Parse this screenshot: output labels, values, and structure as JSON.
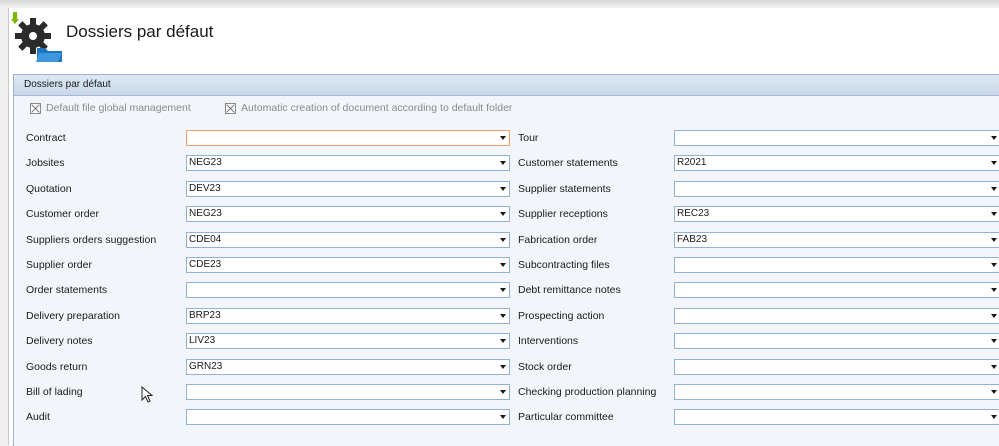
{
  "window": {
    "title": "Dossiers par défaut"
  },
  "panel": {
    "title": "Dossiers par défaut"
  },
  "options": {
    "global_management": "Default file global management",
    "auto_creation": "Automatic creation of document according to default folder"
  },
  "left_fields": [
    {
      "label": "Contract",
      "value": ""
    },
    {
      "label": "Jobsites",
      "value": "NEG23"
    },
    {
      "label": "Quotation",
      "value": "DEV23"
    },
    {
      "label": "Customer order",
      "value": "NEG23"
    },
    {
      "label": "Suppliers orders suggestion",
      "value": "CDE04"
    },
    {
      "label": "Supplier order",
      "value": "CDE23"
    },
    {
      "label": "Order statements",
      "value": ""
    },
    {
      "label": "Delivery preparation",
      "value": "BRP23"
    },
    {
      "label": "Delivery notes",
      "value": "LIV23"
    },
    {
      "label": "Goods return",
      "value": "GRN23"
    },
    {
      "label": "Bill of lading",
      "value": ""
    },
    {
      "label": "Audit",
      "value": ""
    }
  ],
  "right_fields": [
    {
      "label": "Tour",
      "value": ""
    },
    {
      "label": "Customer statements",
      "value": "R2021"
    },
    {
      "label": "Supplier statements",
      "value": ""
    },
    {
      "label": "Supplier receptions",
      "value": "REC23"
    },
    {
      "label": "Fabrication order",
      "value": "FAB23"
    },
    {
      "label": "Subcontracting files",
      "value": ""
    },
    {
      "label": "Debt remittance notes",
      "value": ""
    },
    {
      "label": "Prospecting action",
      "value": ""
    },
    {
      "label": "Interventions",
      "value": ""
    },
    {
      "label": "Stock order",
      "value": ""
    },
    {
      "label": "Checking production planning",
      "value": ""
    },
    {
      "label": "Particular committee",
      "value": ""
    }
  ],
  "icons": {
    "app": "gear-folder-icon",
    "dropdown": "chevron-down-icon",
    "cursor": "mouse-pointer-icon"
  }
}
